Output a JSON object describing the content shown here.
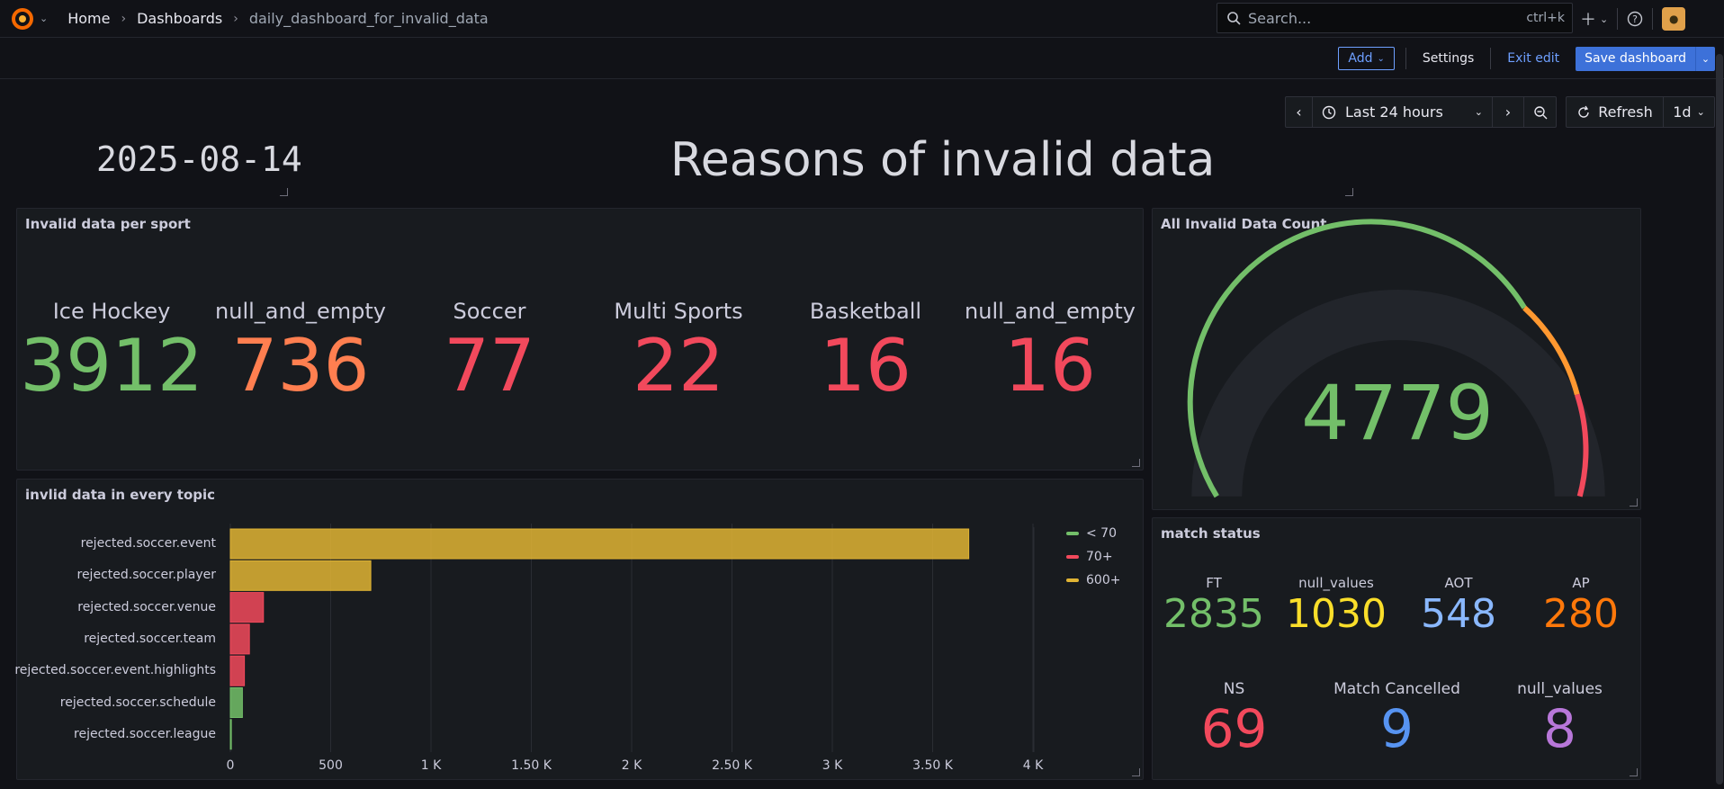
{
  "breadcrumb": {
    "home": "Home",
    "dashboards": "Dashboards",
    "current": "daily_dashboard_for_invalid_data"
  },
  "search": {
    "placeholder": "Search...",
    "shortcut": "ctrl+k"
  },
  "toolbar": {
    "add": "Add",
    "settings": "Settings",
    "exit_edit": "Exit edit",
    "save": "Save dashboard"
  },
  "time": {
    "range": "Last 24 hours",
    "refresh": "Refresh",
    "interval": "1d"
  },
  "date_text": "2025-08-14",
  "heading": "Reasons of invalid data",
  "panels": {
    "sport": {
      "title": "Invalid data per sport",
      "items": [
        {
          "label": "Ice Hockey",
          "value": "3912",
          "color": "#73bf69"
        },
        {
          "label": "null_and_empty",
          "value": "736",
          "color": "#ff7f50"
        },
        {
          "label": "Soccer",
          "value": "77",
          "color": "#f2495c"
        },
        {
          "label": "Multi Sports",
          "value": "22",
          "color": "#f2495c"
        },
        {
          "label": "Basketball",
          "value": "16",
          "color": "#f2495c"
        },
        {
          "label": "null_and_empty",
          "value": "16",
          "color": "#f2495c"
        }
      ]
    },
    "gauge": {
      "title": "All Invalid Data Count",
      "value": "4779",
      "color": "#73bf69"
    },
    "topics": {
      "title": "invlid data in every topic"
    },
    "match": {
      "title": "match status",
      "row1": [
        {
          "label": "FT",
          "value": "2835",
          "color": "#73bf69"
        },
        {
          "label": "null_values",
          "value": "1030",
          "color": "#fade2a"
        },
        {
          "label": "AOT",
          "value": "548",
          "color": "#8ab8ff"
        },
        {
          "label": "AP",
          "value": "280",
          "color": "#ff780a"
        }
      ],
      "row2": [
        {
          "label": "NS",
          "value": "69",
          "color": "#f2495c"
        },
        {
          "label": "Match Cancelled",
          "value": "9",
          "color": "#5794f2"
        },
        {
          "label": "null_values",
          "value": "8",
          "color": "#b877d9"
        }
      ]
    }
  },
  "chart_data": {
    "type": "bar",
    "orientation": "horizontal",
    "categories": [
      "rejected.soccer.event",
      "rejected.soccer.player",
      "rejected.soccer.venue",
      "rejected.soccer.team",
      "rejected.soccer.event.highlights",
      "rejected.soccer.schedule",
      "rejected.soccer.league"
    ],
    "values": [
      3680,
      700,
      165,
      95,
      70,
      60,
      5
    ],
    "xticks": [
      "0",
      "500",
      "1 K",
      "1.50 K",
      "2 K",
      "2.50 K",
      "3 K",
      "3.50 K",
      "4 K"
    ],
    "xlim": [
      0,
      4000
    ],
    "legend": [
      {
        "name": "< 70",
        "color": "#73bf69"
      },
      {
        "name": "70+",
        "color": "#f2495c"
      },
      {
        "name": "600+",
        "color": "#e0b434"
      }
    ],
    "legend_position": "right"
  }
}
